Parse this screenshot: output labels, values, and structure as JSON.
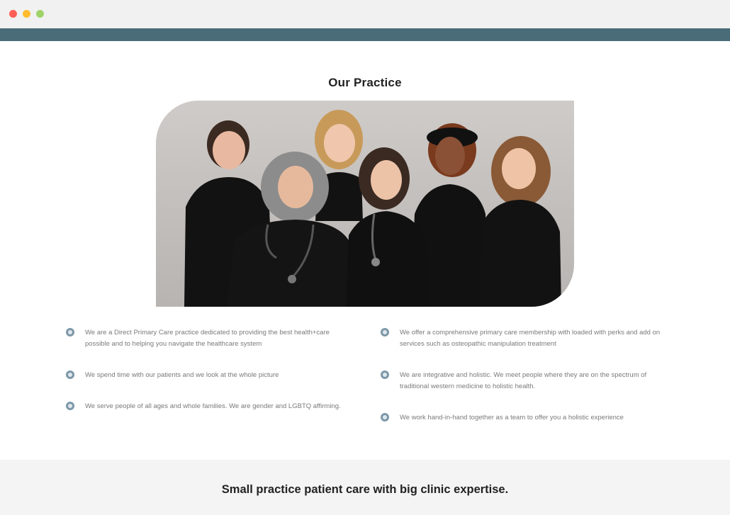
{
  "window": {
    "controls": [
      "close",
      "minimize",
      "zoom"
    ]
  },
  "section": {
    "title": "Our Practice"
  },
  "photo": {
    "description_icon": "team-photo"
  },
  "features": {
    "left": [
      {
        "text": "We are a Direct Primary Care practice dedicated to providing the best health+care possible and to helping you navigate the healthcare system"
      },
      {
        "text": "We spend time with our patients and we look at the whole picture"
      },
      {
        "text": "We serve people of all ages and whole families. We are gender and LGBTQ affirming."
      }
    ],
    "right": [
      {
        "text": "We offer a comprehensive primary care membership with loaded with perks and add on services such as osteopathic manipulation treatment"
      },
      {
        "text": "We are integrative and holistic. We meet people where they are on the spectrum of traditional western medicine to holistic health."
      },
      {
        "text": "We work hand-in-hand together as a team to offer you a holistic experience"
      }
    ]
  },
  "footer": {
    "tagline": "Small practice patient care with big clinic expertise."
  },
  "colors": {
    "nav_strip": "#4a6c78",
    "bullet": "#7d98a8",
    "body_text": "#7a7a7a",
    "heading": "#222222",
    "band": "#f4f4f5"
  }
}
